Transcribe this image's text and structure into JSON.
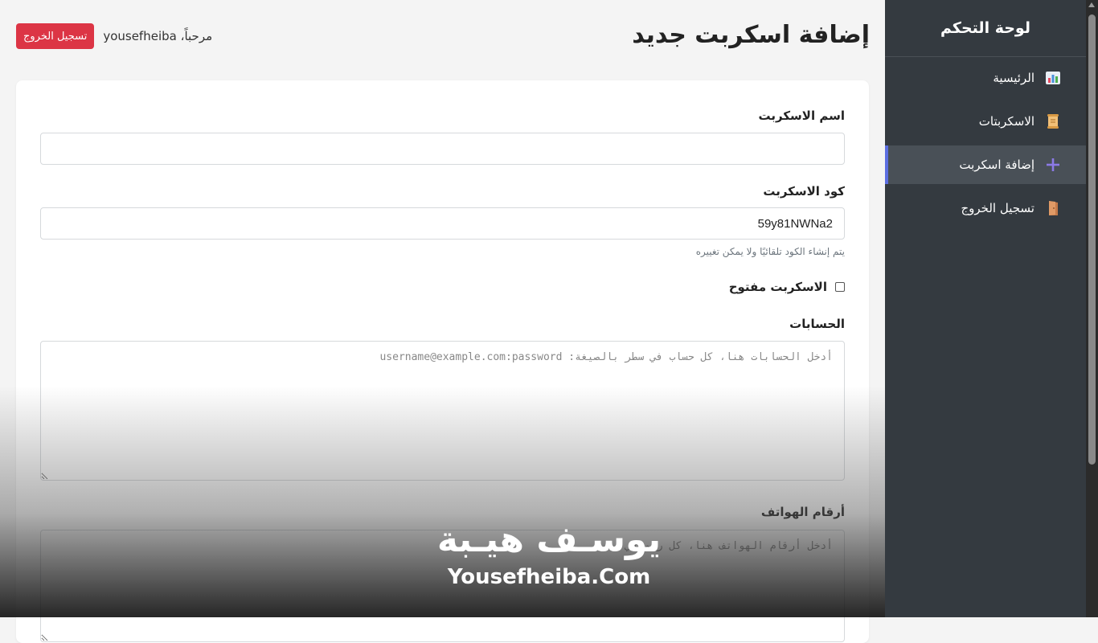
{
  "sidebar": {
    "title": "لوحة التحكم",
    "items": [
      {
        "label": "الرئيسية",
        "icon": "chart-icon"
      },
      {
        "label": "الاسكربتات",
        "icon": "scroll-icon"
      },
      {
        "label": "إضافة اسكربت",
        "icon": "plus-icon",
        "active": true
      },
      {
        "label": "تسجيل الخروج",
        "icon": "door-icon"
      }
    ]
  },
  "header": {
    "title": "إضافة اسكربت جديد",
    "welcome": "مرحباً، yousefheiba",
    "logout_label": "تسجيل الخروج"
  },
  "form": {
    "name_label": "اسم الاسكربت",
    "name_value": "",
    "code_label": "كود الاسكربت",
    "code_value": "59y81NWNa2",
    "code_help": "يتم إنشاء الكود تلقائيًا ولا يمكن تغييره",
    "open_label": "الاسكربت مفتوح",
    "open_checked": false,
    "accounts_label": "الحسابات",
    "accounts_placeholder": "أدخل الحسابات هنا، كل حساب في سطر بالصيغة: username@example.com:password",
    "phones_label": "أرقام الهواتف",
    "phones_placeholder": "أدخل أرقام الهواتف هنا، كل رقم في سطر"
  },
  "watermark": {
    "arabic": "يوسـف هيـبة",
    "english": "Yousefheiba.Com"
  },
  "colors": {
    "sidebar_bg": "#343a40",
    "active_item_bg": "#495057",
    "active_accent": "#5b6ee1",
    "logout_btn": "#dc3545"
  }
}
